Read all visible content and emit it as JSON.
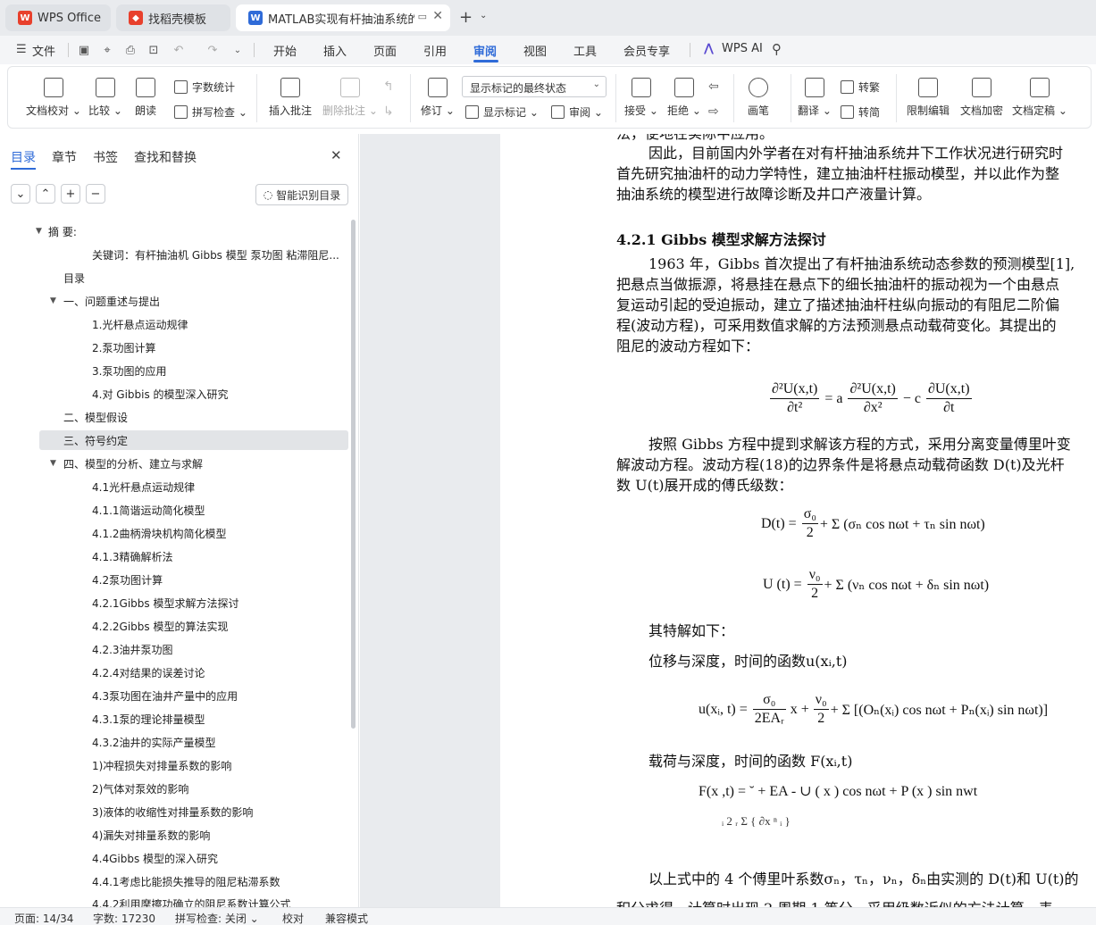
{
  "tabs": [
    {
      "label": "WPS Office"
    },
    {
      "label": "找稻壳模板"
    },
    {
      "label": "MATLAB实现有杆抽油系统的泵"
    }
  ],
  "menu": {
    "file": "文件",
    "items": [
      "开始",
      "插入",
      "页面",
      "引用",
      "审阅",
      "视图",
      "工具",
      "会员专享"
    ],
    "active": "审阅",
    "ai": "WPS AI"
  },
  "ribbon": {
    "doc_check": "文档校对",
    "compare": "比较",
    "read_aloud": "朗读",
    "word_count": "字数统计",
    "spell_check": "拼写检查",
    "insert_comment": "插入批注",
    "delete_comment": "删除批注",
    "revise": "修订",
    "markup_state": "显示标记的最终状态",
    "show_markup": "显示标记",
    "review": "审阅",
    "accept": "接受",
    "reject": "拒绝",
    "ink": "画笔",
    "translate": "翻译",
    "to_traditional": "转繁",
    "to_simplified": "转简",
    "restrict_edit": "限制编辑",
    "doc_encrypt": "文档加密",
    "doc_finalize": "文档定稿",
    "accent_color": "#2f6bd8"
  },
  "sidebar": {
    "tabs": [
      "目录",
      "章节",
      "书签",
      "查找和替换"
    ],
    "smart_toc": "智能识别目录",
    "items": [
      "摘  要:",
      "关键词：有杆抽油机 Gibbs 模型 泵功图 粘滞阻尼...",
      "目录",
      "一、问题重述与提出",
      "1.光杆悬点运动规律",
      "2.泵功图计算",
      "3.泵功图的应用",
      "4.对 Gibbis 的模型深入研究",
      "二、模型假设",
      "三、符号约定",
      "四、模型的分析、建立与求解",
      "4.1光杆悬点运动规律",
      "4.1.1简谐运动简化模型",
      "4.1.2曲柄滑块机构简化模型",
      "4.1.3精确解析法",
      "4.2泵功图计算",
      "4.2.1Gibbs 模型求解方法探讨",
      "4.2.2Gibbs 模型的算法实现",
      "4.2.3油井泵功图",
      "4.2.4对结果的误差讨论",
      "4.3泵功图在油井产量中的应用",
      "4.3.1泵的理论排量模型",
      "4.3.2油井的实际产量模型",
      "1)冲程损失对排量系数的影响",
      "2)气体对泵效的影响",
      "3)液体的收缩性对排量系数的影响",
      "4)漏失对排量系数的影响",
      "4.4Gibbs 模型的深入研究",
      "4.4.1考虑比能损失推导的阻尼粘滞系数",
      "4.4.2利用摩擦功确立的阻尼系数计算公式"
    ]
  },
  "document": {
    "lines": [
      "法，便地在实际中应用。",
      "因此，目前国内外学者在对有杆抽油系统井下工作状况进行研究时",
      "首先研究抽油杆的动力学特性，建立抽油杆柱振动模型，并以此作为整",
      "抽油系统的模型进行故障诊断及井口产液量计算。",
      "4.2.1 Gibbs 模型求解方法探讨",
      "1963 年，Gibbs 首次提出了有杆抽油系统动态参数的预测模型[1],",
      "把悬点当做振源，将悬挂在悬点下的细长抽油杆的振动视为一个由悬点",
      "复运动引起的受迫振动，建立了描述抽油杆柱纵向振动的有阻尼二阶偏",
      "程(波动方程)，可采用数值求解的方法预测悬点动载荷变化。其提出的",
      "阻尼的波动方程如下：",
      "按照 Gibbs 方程中提到求解该方程的方式，采用分离变量傅里叶变",
      "解波动方程。波动方程(18)的边界条件是将悬点动载荷函数  D(t)及光杆",
      "数 U(t)展开成的傅氏级数：",
      "其特解如下：",
      "位移与深度，时间的函数u(xᵢ,t)",
      "载荷与深度，时间的函数  F(xᵢ,t)",
      "以上式中的 4 个傅里叶系数σₙ，τₙ，νₙ，δₙ由实测的 D(t)和 U(t)的",
      "积分求得，计算时出现 2 周期 1 等分，采用级数近似的方法计算，表"
    ],
    "equations": {
      "wave_lhs_num": "∂²U(x,t)",
      "wave_lhs_den": "∂t²",
      "wave_eq": "= a",
      "wave_rhs_num": "∂²U(x,t)",
      "wave_rhs_den": "∂x²",
      "wave_minus": "− c",
      "wave_rhs2_num": "∂U(x,t)",
      "wave_rhs2_den": "∂t",
      "D_lhs": "D(t) =",
      "D_num": "σ₀",
      "D_den": "2",
      "D_rest": "+ Σ (σₙ cos nωt + τₙ sin nωt)",
      "U_lhs": "U (t) =",
      "U_num": "ν₀",
      "U_den": "2",
      "U_rest": "+ Σ (νₙ cos nωt + δₙ sin nωt)",
      "u_lhs": "u(xᵢ, t) =",
      "u_num": "σ₀",
      "u_den": "2EAᵣ",
      "u_mid": "x +",
      "u_num2": "ν₀",
      "u_den2": "2",
      "u_rest": "+ Σ [(Oₙ(xᵢ) cos nωt + Pₙ(xᵢ) sin nωt)]",
      "F_line1": "F(x ,t) = ˘ + EA    -    ∪ ( x   ) cos nωt    +        P (x ) sin nwt",
      "F_line2": "ᵢ          2      ᵣ Σ {  ∂x     ⁿ   ᵢ                    }"
    }
  },
  "status": {
    "page": "页面: 14/34",
    "words": "字数: 17230",
    "spell": "拼写检查: 关闭",
    "proof": "校对",
    "compat": "兼容模式"
  }
}
